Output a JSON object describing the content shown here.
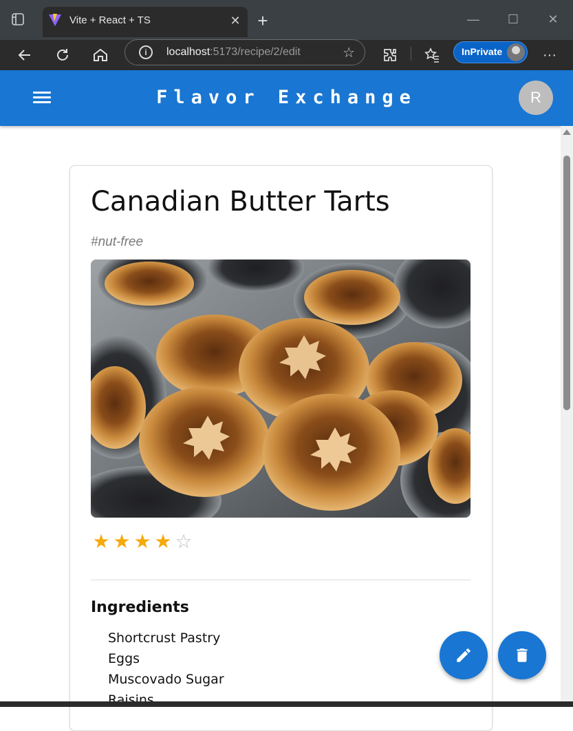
{
  "browser": {
    "tab_title": "Vite + React + TS",
    "url_host": "localhost",
    "url_path": ":5173/recipe/2/edit",
    "inprivate_label": "InPrivate"
  },
  "app": {
    "brand": "Flavor Exchange",
    "user_initial": "R",
    "primary_color": "#1976d2"
  },
  "recipe": {
    "title": "Canadian Butter Tarts",
    "tag": "#nut-free",
    "rating": 4,
    "rating_max": 5,
    "star_color": "#f5a90b",
    "ingredients_heading": "Ingredients",
    "ingredients": [
      "Shortcrust Pastry",
      "Eggs",
      "Muscovado Sugar",
      "Raisins"
    ]
  },
  "icons": {
    "menu": "menu-icon",
    "edit": "pencil-icon",
    "delete": "trash-icon"
  }
}
